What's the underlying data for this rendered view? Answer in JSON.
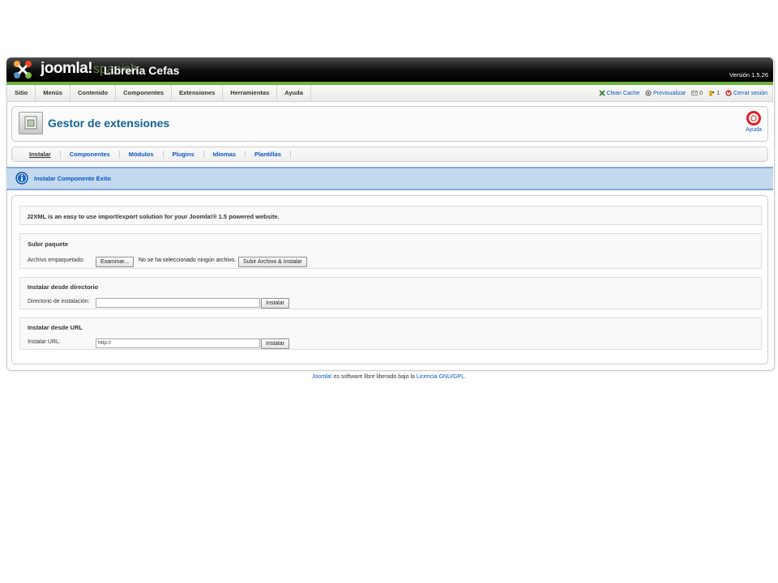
{
  "header": {
    "logo_text": "joomla!",
    "logo_sub": "spanish",
    "site_name": "Librería Cefas",
    "version": "Versión 1.5.26"
  },
  "menu": [
    {
      "label": "Sitio"
    },
    {
      "label": "Menús"
    },
    {
      "label": "Contenido"
    },
    {
      "label": "Componentes"
    },
    {
      "label": "Extensiones"
    },
    {
      "label": "Herramientas"
    },
    {
      "label": "Ayuda"
    }
  ],
  "status": {
    "clean_cache": "Clean Cache",
    "preview": "Previsualizar",
    "messages_count": "0",
    "users_count": "1",
    "logout": "Cerrar sesión"
  },
  "toolbar": {
    "title": "Gestor de extensiones",
    "help_label": "Ayuda"
  },
  "submenu": [
    {
      "label": "Instalar",
      "active": true
    },
    {
      "label": "Componentes"
    },
    {
      "label": "Módulos"
    },
    {
      "label": "Plugins"
    },
    {
      "label": "Idiomas"
    },
    {
      "label": "Plantillas"
    }
  ],
  "message": {
    "text": "Instalar Componente Éxito"
  },
  "install": {
    "description": "J2XML is an easy to use import/export solution for your Joomla!® 1.5 powered website.",
    "upload": {
      "legend": "Subir paquete",
      "label": "Archivo empaquetado:",
      "browse_button": "Examinar...",
      "no_file": "No se ha seleccionado ningún archivo.",
      "submit_button": "Subir Archivo & Instalar"
    },
    "directory": {
      "legend": "Instalar desde directorio",
      "label": "Directorio de instalación:",
      "value": "",
      "button": "Instalar"
    },
    "url": {
      "legend": "Instalar desde URL",
      "label": "Instalar URL:",
      "value": "http://",
      "button": "Instalar"
    }
  },
  "footer": {
    "joomla_link": "Joomla!",
    "middle": " es software libre liberado bajo la ",
    "license_link": "Licencia GNU/GPL",
    "end": "."
  },
  "colors": {
    "header_green": "#6cb33f",
    "link_blue": "#0b55c4",
    "title_blue": "#146295",
    "message_bg": "#c3d9ee"
  }
}
